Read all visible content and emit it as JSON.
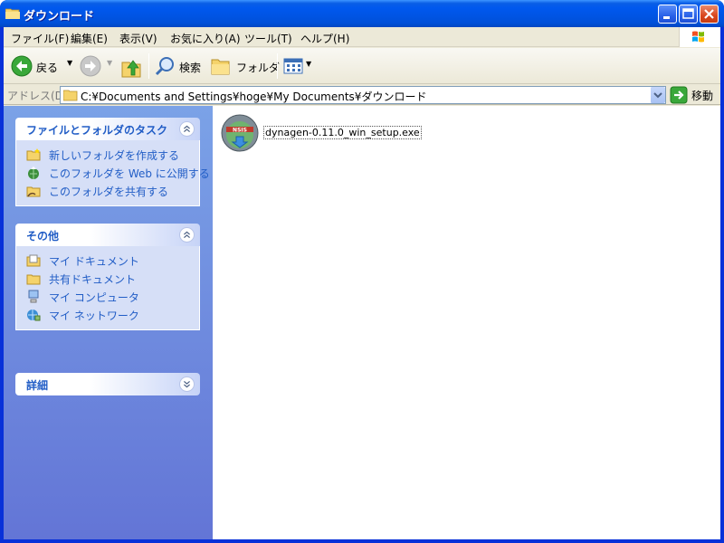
{
  "window": {
    "title": "ダウンロード"
  },
  "menu": [
    "ファイル(F)",
    "編集(E)",
    "表示(V)",
    "お気に入り(A)",
    "ツール(T)",
    "ヘルプ(H)"
  ],
  "toolbar": {
    "back_label": "戻る",
    "search_label": "検索",
    "folders_label": "フォルダ"
  },
  "address": {
    "label": "アドレス(D)",
    "value": "C:¥Documents and Settings¥hoge¥My Documents¥ダウンロード",
    "go_label": "移動"
  },
  "tasks": {
    "file_folder": {
      "title": "ファイルとフォルダのタスク",
      "items": [
        {
          "label": "新しいフォルダを作成する",
          "icon": "new-folder-icon"
        },
        {
          "label": "このフォルダを Web に公開する",
          "icon": "web-publish-icon"
        },
        {
          "label": "このフォルダを共有する",
          "icon": "share-folder-icon"
        }
      ]
    },
    "other": {
      "title": "その他",
      "items": [
        {
          "label": "マイ ドキュメント",
          "icon": "my-documents-icon"
        },
        {
          "label": "共有ドキュメント",
          "icon": "shared-documents-icon"
        },
        {
          "label": "マイ コンピュータ",
          "icon": "my-computer-icon"
        },
        {
          "label": "マイ ネットワーク",
          "icon": "my-network-icon"
        }
      ]
    },
    "details": {
      "title": "詳細"
    }
  },
  "files": [
    {
      "name": "dynagen-0.11.0_win_setup.exe",
      "icon": "nsis-installer-icon",
      "icon_text": "NSIS"
    }
  ]
}
